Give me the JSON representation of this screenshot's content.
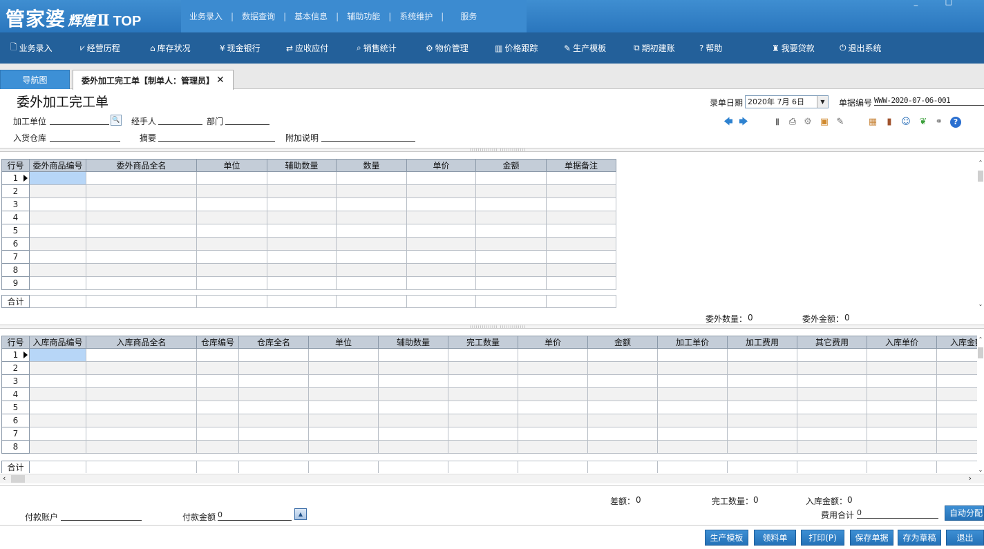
{
  "app": {
    "logo_main": "管家婆",
    "logo_sub": "辉煌",
    "logo_roman": "Ⅱ",
    "logo_top": "TOP",
    "top_menu": [
      "业务录入",
      "数据查询",
      "基本信息",
      "辅助功能",
      "系统维护",
      "服务"
    ],
    "top_sep": "|",
    "window_controls": "_ □"
  },
  "toolbar": {
    "items": [
      {
        "icon": "document-icon",
        "glyph": "🗋",
        "label": "业务录入"
      },
      {
        "icon": "line-chart-icon",
        "glyph": "⩗",
        "label": "经营历程"
      },
      {
        "icon": "house-icon",
        "glyph": "⌂",
        "label": "库存状况"
      },
      {
        "icon": "yen-icon",
        "glyph": "¥",
        "label": "现金银行"
      },
      {
        "icon": "exchange-icon",
        "glyph": "⇄",
        "label": "应收应付"
      },
      {
        "icon": "search-icon",
        "glyph": "⌕",
        "label": "销售统计"
      },
      {
        "icon": "gear-icon",
        "glyph": "⚙",
        "label": "物价管理"
      },
      {
        "icon": "bar-chart-icon",
        "glyph": "▥",
        "label": "价格跟踪"
      },
      {
        "icon": "wrench-icon",
        "glyph": "✎",
        "label": "生产模板"
      },
      {
        "icon": "external-link-icon",
        "glyph": "⧉",
        "label": "期初建账"
      },
      {
        "icon": "help-icon",
        "glyph": "?",
        "label": "帮助"
      },
      {
        "icon": "money-bag-icon",
        "glyph": "♜",
        "label": "我要贷款"
      },
      {
        "icon": "power-icon",
        "glyph": "⏻",
        "label": "退出系统"
      }
    ]
  },
  "tabs": {
    "nav_label": "导航图",
    "doc_label": "委外加工完工单【制单人：管理员】",
    "close_glyph": "✕"
  },
  "form": {
    "title": "委外加工完工单",
    "date_label": "录单日期",
    "date_value": "2020年  7月  6日",
    "date_dropdown": "▼",
    "billno_label": "单据编号",
    "billno_value": "WWW-2020-07-06-001",
    "proc_unit_label": "加工单位",
    "search_glyph": "🔍",
    "handler_label": "经手人",
    "dept_label": "部门",
    "warehouse_label": "入货仓库",
    "summary_label": "摘要",
    "note_label": "附加说明"
  },
  "icons": {
    "left_arrow": "🡄",
    "right_arrow": "🡆",
    "barcode": "|||",
    "printer": "⎙",
    "gear": "⚙",
    "box_add": "▣",
    "edit": "✎",
    "package": "▦",
    "door": "▮",
    "user": "☺",
    "leaf": "❦",
    "link": "⚭",
    "help": "?"
  },
  "grid1": {
    "headers": [
      "行号",
      "委外商品编号",
      "委外商品全名",
      "单位",
      "辅助数量",
      "数量",
      "单价",
      "金额",
      "单据备注"
    ],
    "rows": [
      "1",
      "2",
      "3",
      "4",
      "5",
      "6",
      "7",
      "8",
      "9"
    ],
    "sum_label": "合计",
    "qty_label": "委外数量：",
    "qty_value": "0",
    "amount_label": "委外金额：",
    "amount_value": "0"
  },
  "grid2": {
    "headers": [
      "行号",
      "入库商品编号",
      "入库商品全名",
      "仓库编号",
      "仓库全名",
      "单位",
      "辅助数量",
      "完工数量",
      "单价",
      "金额",
      "加工单价",
      "加工费用",
      "其它费用",
      "入库单价",
      "入库金额"
    ],
    "rows": [
      "1",
      "2",
      "3",
      "4",
      "5",
      "6",
      "7",
      "8"
    ],
    "sum_label": "合计"
  },
  "footer": {
    "diff_label": "差额：",
    "diff_value": "0",
    "done_qty_label": "完工数量：",
    "done_qty_value": "0",
    "in_amount_label": "入库金额：",
    "in_amount_value": "0",
    "pay_account_label": "付款账户",
    "pay_amount_label": "付款金额",
    "pay_amount_value": "0",
    "fee_total_label": "费用合计",
    "fee_total_value": "0",
    "auto_alloc": "自动分配",
    "buttons": [
      "生产模板",
      "领料单",
      "打印(P)",
      "保存单据",
      "存为草稿",
      "退出"
    ],
    "scroll_up": "▲"
  }
}
